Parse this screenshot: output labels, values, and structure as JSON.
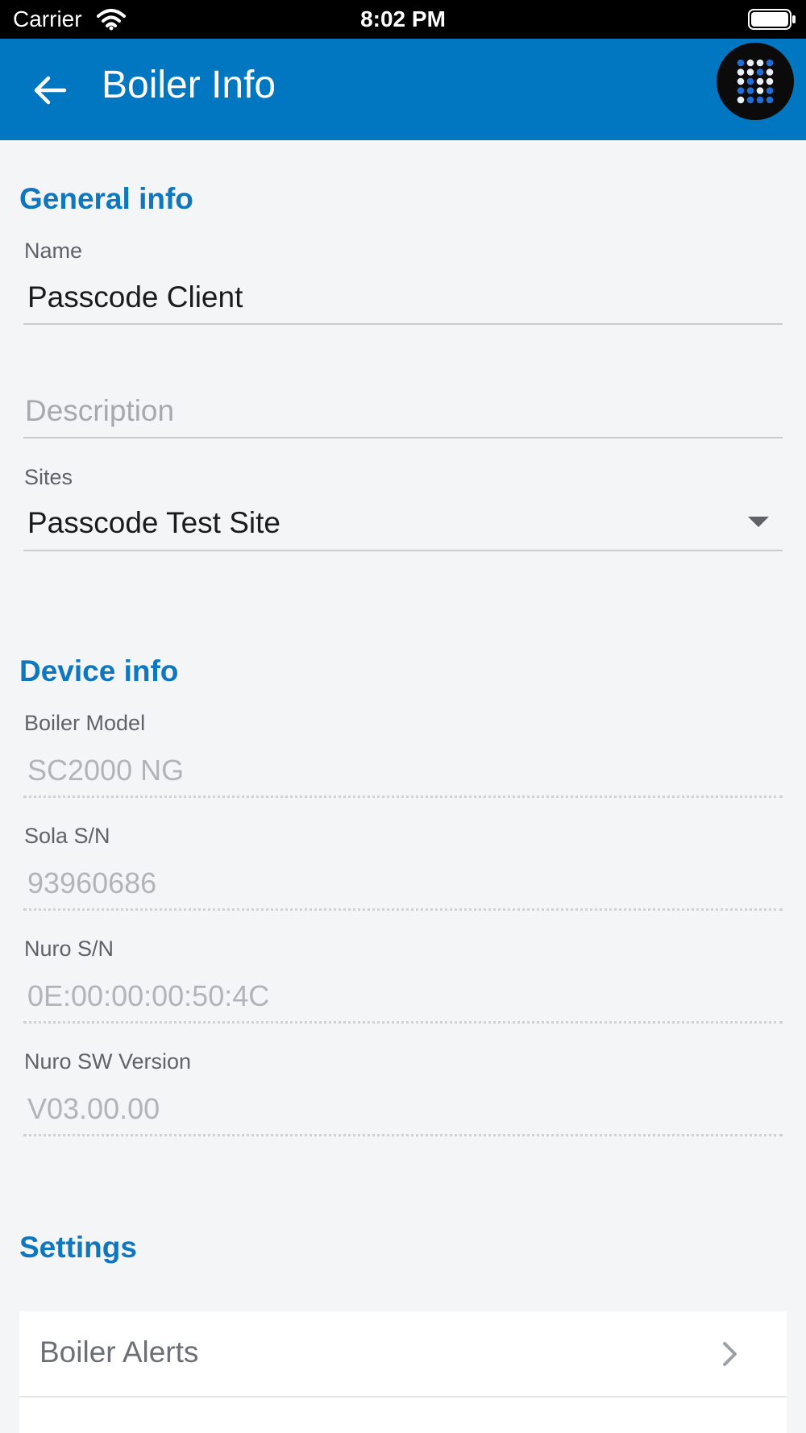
{
  "status_bar": {
    "carrier": "Carrier",
    "time": "8:02 PM"
  },
  "app_bar": {
    "title": "Boiler Info",
    "back_icon": "arrow-left-icon",
    "logo_icon": "dot-grid-logo-icon",
    "background_color": "#0077c0"
  },
  "general_info": {
    "title": "General info",
    "name_label": "Name",
    "name_value": "Passcode Client",
    "description_placeholder": "Description",
    "sites_label": "Sites",
    "sites_value": "Passcode Test Site"
  },
  "device_info": {
    "title": "Device info",
    "fields": [
      {
        "label": "Boiler Model",
        "value": "SC2000 NG"
      },
      {
        "label": "Sola S/N",
        "value": "93960686"
      },
      {
        "label": "Nuro S/N",
        "value": "0E:00:00:00:50:4C"
      },
      {
        "label": "Nuro SW Version",
        "value": "V03.00.00"
      }
    ]
  },
  "settings": {
    "title": "Settings",
    "items": [
      {
        "label": "Boiler Alerts",
        "icon": "chevron-right-icon"
      }
    ]
  },
  "colors": {
    "accent": "#0f77bf",
    "background": "#f3f5f7"
  }
}
